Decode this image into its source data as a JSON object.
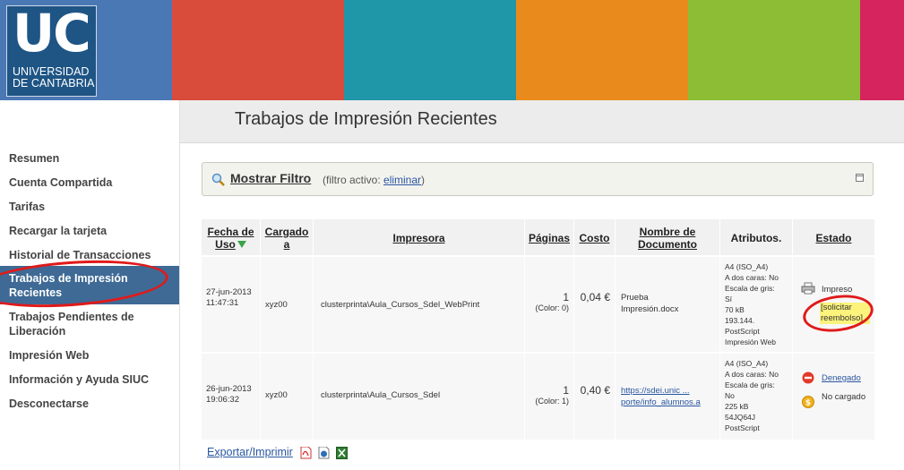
{
  "brand": {
    "logo_main": "UC",
    "logo_line1": "UNIVERSIDAD",
    "logo_line2": "DE CANTABRIA",
    "colors": [
      "#4a78b5",
      "#d94b3a",
      "#2097a8",
      "#e88a1c",
      "#8cbd35",
      "#f5a91b",
      "#d5245e"
    ]
  },
  "sidebar": {
    "items": [
      {
        "label": "Resumen"
      },
      {
        "label": "Cuenta Compartida"
      },
      {
        "label": "Tarifas"
      },
      {
        "label": "Recargar la tarjeta"
      },
      {
        "label": "Historial de Transacciones"
      },
      {
        "label": "Trabajos de Impresión Recientes",
        "active": true
      },
      {
        "label": "Trabajos Pendientes de Liberación"
      },
      {
        "label": "Impresión Web"
      },
      {
        "label": "Información y Ayuda SIUC"
      },
      {
        "label": "Desconectarse"
      }
    ]
  },
  "page": {
    "title": "Trabajos de Impresión Recientes"
  },
  "filter": {
    "label": "Mostrar Filtro",
    "note_prefix": "(filtro activo: ",
    "note_link": "eliminar",
    "note_suffix": ")"
  },
  "table": {
    "headers": {
      "date": "Fecha de Uso",
      "charged": "Cargado a",
      "printer": "Impresora",
      "pages": "Páginas",
      "cost": "Costo",
      "doc": "Nombre de Documento",
      "attrs": "Atributos.",
      "status": "Estado"
    },
    "rows": [
      {
        "date": "27-jun-2013 11:47:31",
        "charged": "xyz00",
        "printer": "clusterprinta\\Aula_Cursos_Sdel_WebPrint",
        "pages": "1",
        "color": "(Color: 0)",
        "cost": "0,04 €",
        "doc": "Prueba Impresión.docx",
        "attrs": [
          "A4 (ISO_A4)",
          "A dos caras: No",
          "Escala de gris:",
          "Sí",
          "70 kB",
          "193.144.",
          "PostScript",
          "Impresión Web"
        ],
        "status": "Impreso",
        "action": "[solicitar reembolso]"
      },
      {
        "date": "26-jun-2013 19:06:32",
        "charged": "xyz00",
        "printer": "clusterprinta\\Aula_Cursos_Sdel",
        "pages": "1",
        "color": "(Color: 1)",
        "cost": "0,40 €",
        "doc_line1": "https://sdei.unic ...",
        "doc_line2": "porte/info_alumnos.a",
        "attrs": [
          "A4 (ISO_A4)",
          "A dos caras: No",
          "Escala de gris:",
          "No",
          "225 kB",
          "54JQ64J",
          "PostScript"
        ],
        "status": "Denegado",
        "status2": "No cargado"
      }
    ]
  },
  "export": {
    "label": "Exportar/Imprimir"
  }
}
